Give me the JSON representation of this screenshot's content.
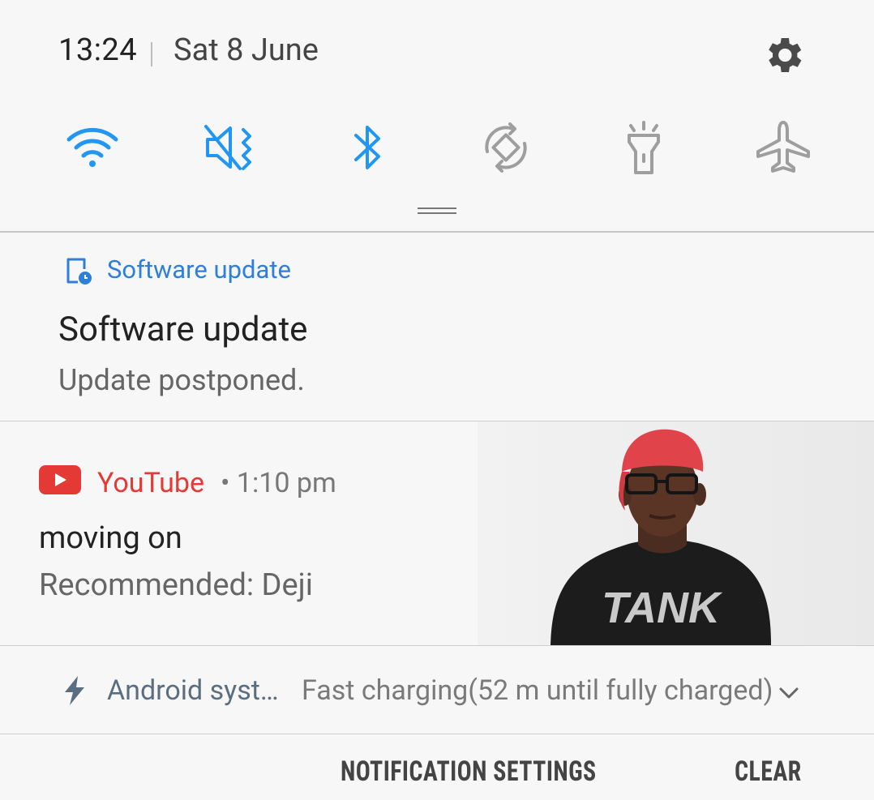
{
  "status": {
    "time": "13:24",
    "date": "Sat 8 June"
  },
  "quick_settings": [
    {
      "name": "wifi-icon",
      "active": true
    },
    {
      "name": "mute-vibrate-icon",
      "active": true
    },
    {
      "name": "bluetooth-icon",
      "active": true
    },
    {
      "name": "auto-rotate-icon",
      "active": false
    },
    {
      "name": "flashlight-icon",
      "active": false
    },
    {
      "name": "airplane-mode-icon",
      "active": false
    }
  ],
  "colors": {
    "active": "#2196f3",
    "inactive": "#9e9e9e",
    "youtube": "#e53935"
  },
  "notifications": {
    "software_update": {
      "app": "Software update",
      "title": "Software update",
      "text": "Update postponed."
    },
    "youtube": {
      "app": "YouTube",
      "time": "• 1:10 pm",
      "title": "moving on",
      "text": "Recommended: Deji",
      "thumb_shirt_text": "TANK"
    },
    "system": {
      "app": "Android syst…",
      "text": "Fast charging(52 m until fully charged)"
    }
  },
  "footer": {
    "settings_label": "NOTIFICATION SETTINGS",
    "clear_label": "CLEAR"
  }
}
